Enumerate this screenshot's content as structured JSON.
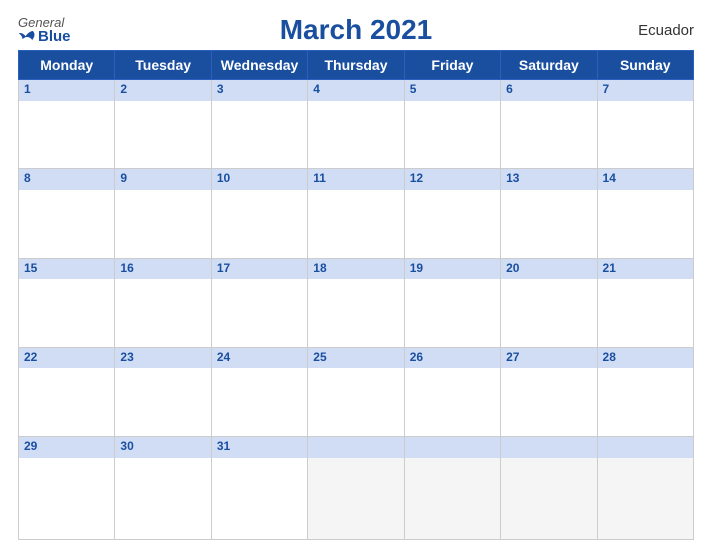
{
  "header": {
    "logo_general": "General",
    "logo_blue": "Blue",
    "title": "March 2021",
    "country": "Ecuador"
  },
  "days": [
    "Monday",
    "Tuesday",
    "Wednesday",
    "Thursday",
    "Friday",
    "Saturday",
    "Sunday"
  ],
  "weeks": [
    [
      1,
      2,
      3,
      4,
      5,
      6,
      7
    ],
    [
      8,
      9,
      10,
      11,
      12,
      13,
      14
    ],
    [
      15,
      16,
      17,
      18,
      19,
      20,
      21
    ],
    [
      22,
      23,
      24,
      25,
      26,
      27,
      28
    ],
    [
      29,
      30,
      31,
      null,
      null,
      null,
      null
    ]
  ],
  "accent_color": "#1a4fa0"
}
